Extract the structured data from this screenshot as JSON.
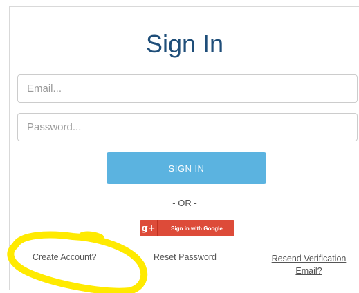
{
  "signin_form": {
    "title": "Sign In",
    "email": {
      "placeholder": "Email..."
    },
    "password": {
      "placeholder": "Password..."
    },
    "signin_button_label": "SIGN IN",
    "or_separator": "- OR -",
    "google_button": {
      "icon_text": "g+",
      "label": "Sign in with Google"
    }
  },
  "footer_links": {
    "create_account": "Create Account?",
    "reset_password": "Reset Password",
    "resend_verification": "Resend Verification Email?"
  },
  "colors": {
    "title": "#1f4e79",
    "signin_button": "#5bb3e0",
    "google_button": "#dd4b39",
    "highlight": "#ffea00"
  }
}
